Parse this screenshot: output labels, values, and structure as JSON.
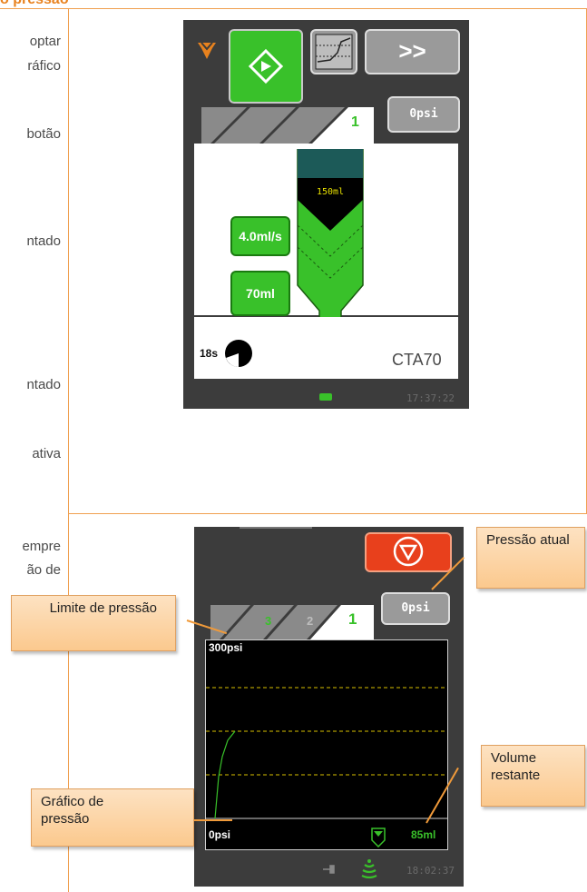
{
  "heading": "o pressão",
  "left_column": {
    "upper": [
      "optar",
      "ráfico",
      "botão",
      "ntado",
      "ntado",
      "ativa"
    ],
    "lower": [
      "empre",
      "ão de"
    ]
  },
  "screen1": {
    "start_icon": "diamond-start-icon",
    "graph_icon": "pressure-graph-icon",
    "next_label": ">>",
    "pressure": "0psi",
    "active_phase": "1",
    "syringe_volume": "150ml",
    "flow_rate": "4.0ml/s",
    "volume": "70ml",
    "duration": "18s",
    "protocol": "CTA70",
    "clock": "17:37:22",
    "colors": {
      "accent": "#39c12a",
      "screen": "#3c3c3c",
      "phase": "#39c12a"
    }
  },
  "screen2": {
    "stop_icon": "stop-icon",
    "pressure": "0psi",
    "tabs": [
      "3",
      "2",
      "1"
    ],
    "pressure_max": "300psi",
    "pressure_min": "0psi",
    "remaining_volume": "85ml",
    "clock": "18:02:37",
    "colors": {
      "stop": "#e8401c",
      "limit_line": "#d8c000",
      "curve": "#39c12a"
    }
  },
  "callouts": {
    "current_pressure": "Pressão atual",
    "pressure_limit": "Limite de pressão",
    "remaining_volume": "Volume restante",
    "pressure_graph": "Gráfico de pressão"
  }
}
